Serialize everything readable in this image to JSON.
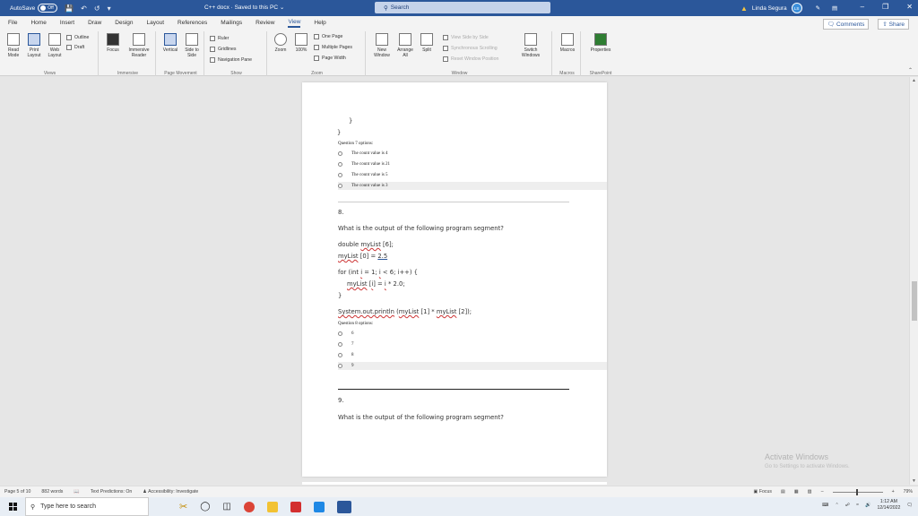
{
  "titlebar": {
    "autosave_label": "AutoSave",
    "autosave_state": "Off",
    "doc_title": "C++ docx · Saved to this PC",
    "search_placeholder": "Search",
    "user_name": "Linda Segura",
    "user_initials": "LS",
    "accent": "#2b579a"
  },
  "tabs": [
    "File",
    "Home",
    "Insert",
    "Draw",
    "Design",
    "Layout",
    "References",
    "Mailings",
    "Review",
    "View",
    "Help"
  ],
  "active_tab": "View",
  "tab_actions": {
    "comments": "Comments",
    "share": "Share"
  },
  "ribbon": {
    "views": {
      "read_mode": "Read Mode",
      "print_layout": "Print Layout",
      "web_layout": "Web Layout",
      "outline": "Outline",
      "draft": "Draft",
      "group": "Views"
    },
    "immersive": {
      "focus": "Focus",
      "reader": "Immersive Reader",
      "group": "Immersive"
    },
    "page_movement": {
      "vertical": "Vertical",
      "side": "Side to Side",
      "group": "Page Movement"
    },
    "show": {
      "ruler": "Ruler",
      "gridlines": "Gridlines",
      "nav_pane": "Navigation Pane",
      "group": "Show"
    },
    "zoom": {
      "zoom": "Zoom",
      "pct": "100%",
      "one_page": "One Page",
      "multiple_pages": "Multiple Pages",
      "page_width": "Page Width",
      "group": "Zoom"
    },
    "window": {
      "new_window": "New Window",
      "arrange_all": "Arrange All",
      "split": "Split",
      "side_by_side": "View Side by Side",
      "sync_scroll": "Synchronous Scrolling",
      "reset_pos": "Reset Window Position",
      "switch": "Switch Windows",
      "group": "Window"
    },
    "macros": {
      "macros": "Macros",
      "group": "Macros"
    },
    "sharepoint": {
      "properties": "Properties",
      "group": "SharePoint"
    }
  },
  "document": {
    "brace1": "}",
    "brace2": "}",
    "q7_options_label": "Question 7 options:",
    "q7_options": [
      "The count value is 4",
      "The count value is 21",
      "The count value is 5",
      "The count value is 3"
    ],
    "q8_number": "8.",
    "q8_text": "What is the output of the following program segment?",
    "code": {
      "l1a": "double ",
      "l1b": "myList",
      "l1c": " [6];",
      "l2a": "myList",
      "l2b": " [0] = ",
      "l2c": "2.5",
      "l3a": "for (int ",
      "l3b": "i",
      "l3c": " = 1; ",
      "l3d": "i",
      "l3e": " < 6; ",
      "l3f": "i++",
      "l3g": ") {",
      "l4a": "myList",
      "l4b": " [",
      "l4c": "i",
      "l4d": "] = ",
      "l4e": "i",
      "l4f": " * 2.0;",
      "l5": "}",
      "l6a": "System.out.println",
      "l6b": " (",
      "l6c": "myList",
      "l6d": " [1] * ",
      "l6e": "myList",
      "l6f": " [2]);"
    },
    "q8_options_label": "Question 8 options:",
    "q8_options": [
      "6",
      "7",
      "8",
      "9"
    ],
    "q9_number": "9.",
    "q9_text": "What is the output of the following program segment?"
  },
  "watermark": {
    "line1": "Activate Windows",
    "line2": "Go to Settings to activate Windows."
  },
  "statusbar": {
    "page": "Page 5 of 10",
    "words": "882 words",
    "predictions": "Text Predictions: On",
    "accessibility": "Accessibility: Investigate",
    "focus": "Focus",
    "zoom_pct": "79%"
  },
  "taskbar": {
    "search_placeholder": "Type here to search",
    "time": "1:12 AM",
    "date": "12/14/2022"
  }
}
